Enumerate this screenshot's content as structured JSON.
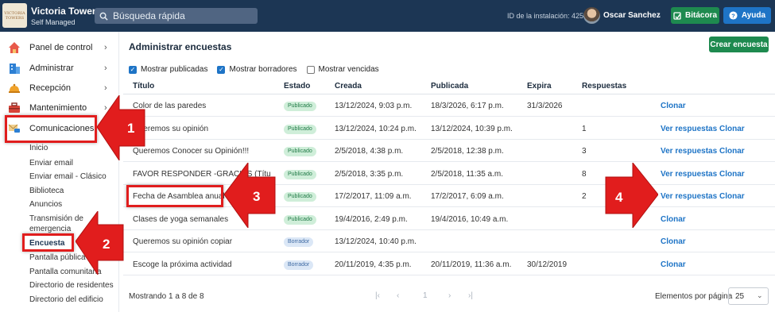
{
  "app": {
    "logo_text": "VICTORIA TOWERS",
    "name": "Victoria Towers",
    "subtitle": "Self Managed",
    "search_placeholder": "Búsqueda rápida",
    "install_id": "ID de la instalación: 4254",
    "user": "Oscar Sanchez",
    "bitacora": "Bitácora",
    "ayuda": "Ayuda"
  },
  "sidebar": {
    "items": [
      {
        "label": "Panel de control",
        "icon": "house-icon"
      },
      {
        "label": "Administrar",
        "icon": "building-icon"
      },
      {
        "label": "Recepción",
        "icon": "bell-icon"
      },
      {
        "label": "Mantenimiento",
        "icon": "toolbox-icon"
      },
      {
        "label": "Comunicaciones",
        "icon": "mail-chat-icon"
      }
    ],
    "subitems": [
      "Inicio",
      "Enviar email",
      "Enviar email - Clásico",
      "Biblioteca",
      "Anuncios",
      "Transmisión de",
      "emergencia",
      "Encuesta",
      "Pantalla pública - c",
      "Pantalla comunitaria",
      "Directorio de residentes",
      "Directorio del edificio"
    ]
  },
  "main": {
    "title": "Administrar encuestas",
    "create_button": "Crear encuesta",
    "filters": [
      {
        "label": "Mostrar publicadas",
        "checked": true
      },
      {
        "label": "Mostrar borradores",
        "checked": true
      },
      {
        "label": "Mostrar vencidas",
        "checked": false
      }
    ],
    "columns": [
      "Título",
      "Estado",
      "Creada",
      "Publicada",
      "Expira",
      "Respuestas"
    ],
    "rows": [
      {
        "title": "Color de las paredes",
        "status": "Publicado",
        "created": "13/12/2024, 9:03 p.m.",
        "published": "18/3/2026, 6:17 p.m.",
        "expires": "31/3/2026",
        "responses": "",
        "action1": "Clonar",
        "action2": ""
      },
      {
        "title": "Queremos su opinión",
        "status": "Publicado",
        "created": "13/12/2024, 10:24 p.m.",
        "published": "13/12/2024, 10:39 p.m.",
        "expires": "",
        "responses": "1",
        "action1": "Ver respuestas",
        "action2": "Clonar"
      },
      {
        "title": "Queremos Conocer su Opinión!!!",
        "status": "Publicado",
        "created": "2/5/2018, 4:38 p.m.",
        "published": "2/5/2018, 12:38 p.m.",
        "expires": "",
        "responses": "3",
        "action1": "Ver respuestas",
        "action2": "Clonar"
      },
      {
        "title": "FAVOR RESPONDER -GRACIAS (Títu",
        "status": "Publicado",
        "created": "2/5/2018, 3:35 p.m.",
        "published": "2/5/2018, 11:35 a.m.",
        "expires": "",
        "responses": "8",
        "action1": "Ver respuestas",
        "action2": "Clonar"
      },
      {
        "title": "Fecha de Asamblea anual",
        "status": "Publicado",
        "created": "17/2/2017, 11:09 a.m.",
        "published": "17/2/2017, 6:09 a.m.",
        "expires": "",
        "responses": "2",
        "action1": "Ver respuestas",
        "action2": "Clonar"
      },
      {
        "title": "Clases de yoga semanales",
        "status": "Publicado",
        "created": "19/4/2016, 2:49 p.m.",
        "published": "19/4/2016, 10:49 a.m.",
        "expires": "",
        "responses": "",
        "action1": "Clonar",
        "action2": ""
      },
      {
        "title": "Queremos su opinión copiar",
        "status": "Borrador",
        "created": "13/12/2024, 10:40 p.m.",
        "published": "",
        "expires": "",
        "responses": "",
        "action1": "Clonar",
        "action2": ""
      },
      {
        "title": "Escoge la próxima actividad",
        "status": "Borrador",
        "created": "20/11/2019, 4:35 p.m.",
        "published": "20/11/2019, 11:36 a.m.",
        "expires": "30/12/2019",
        "responses": "",
        "action1": "Clonar",
        "action2": ""
      }
    ],
    "footer": {
      "showing": "Mostrando 1 a 8 de 8",
      "page": "1",
      "per_page_label": "Elementos por página",
      "per_page": "25"
    }
  },
  "annotations": {
    "callouts": [
      "1",
      "2",
      "3",
      "4"
    ],
    "color": "#e11d1d"
  }
}
